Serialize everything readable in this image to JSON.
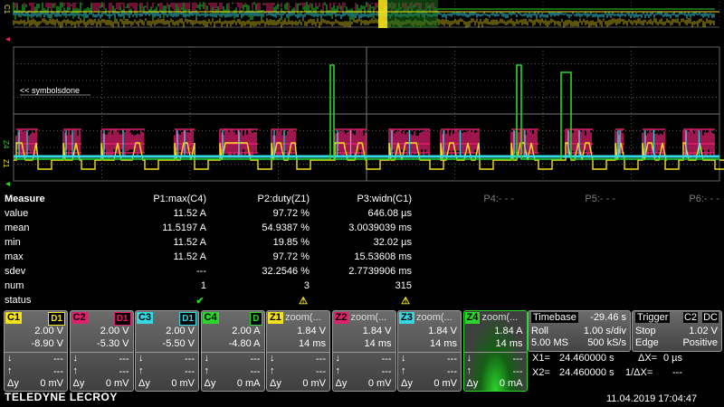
{
  "markers": {
    "c1": "C1",
    "z4": "Z4",
    "z1": "Z1"
  },
  "annotation": "<< symbolsdone",
  "measure": {
    "title": "Measure",
    "columns": [
      "P1:max(C4)",
      "P2:duty(Z1)",
      "P3:widn(C1)",
      "P4:- - -",
      "P5:- - -",
      "P6:- - -"
    ],
    "rows": [
      {
        "label": "value",
        "cells": [
          "11.52 A",
          "97.72 %",
          "646.08 µs"
        ]
      },
      {
        "label": "mean",
        "cells": [
          "11.5197 A",
          "54.9387 %",
          "3.0039039 ms"
        ]
      },
      {
        "label": "min",
        "cells": [
          "11.52 A",
          "19.85 %",
          "32.02 µs"
        ]
      },
      {
        "label": "max",
        "cells": [
          "11.52 A",
          "97.72 %",
          "15.53608 ms"
        ]
      },
      {
        "label": "sdev",
        "cells": [
          "---",
          "32.2546 %",
          "2.7739906 ms"
        ]
      },
      {
        "label": "num",
        "cells": [
          "1",
          "3",
          "315"
        ]
      },
      {
        "label": "status",
        "cells": [
          "✔",
          "⚠",
          "⚠"
        ]
      }
    ]
  },
  "channels": [
    {
      "tag": "C1",
      "coupling": "D1",
      "color": "#f3e21b",
      "v1": "2.00 V",
      "v2": "-8.90 V",
      "dn": "---",
      "up": "---",
      "dy": "0 mV"
    },
    {
      "tag": "C2",
      "coupling": "D1",
      "color": "#e0206e",
      "v1": "2.00 V",
      "v2": "-5.30 V",
      "dn": "---",
      "up": "---",
      "dy": "0 mV"
    },
    {
      "tag": "C3",
      "coupling": "D1",
      "color": "#34d8e3",
      "v1": "2.00 V",
      "v2": "-5.50 V",
      "dn": "---",
      "up": "---",
      "dy": "0 mV"
    },
    {
      "tag": "C4",
      "coupling": "D",
      "color": "#2bd52b",
      "v1": "2.00 A",
      "v2": "-4.80 A",
      "dn": "---",
      "up": "---",
      "dy": "0 mA"
    },
    {
      "tag": "Z1",
      "zoom": "zoom(...",
      "color": "#f3e21b",
      "v1": "1.84 V",
      "v2": "14 ms",
      "dn": "---",
      "up": "---",
      "dy": "0 mV"
    },
    {
      "tag": "Z2",
      "zoom": "zoom(...",
      "color": "#e0206e",
      "v1": "1.84 V",
      "v2": "14 ms",
      "dn": "---",
      "up": "---",
      "dy": "0 mV"
    },
    {
      "tag": "Z3",
      "zoom": "zoom(...",
      "color": "#34d8e3",
      "v1": "1.84 V",
      "v2": "14 ms",
      "dn": "---",
      "up": "---",
      "dy": "0 mV"
    },
    {
      "tag": "Z4",
      "zoom": "zoom(...",
      "color": "#2bd52b",
      "v1": "1.84 A",
      "v2": "14 ms",
      "dn": "---",
      "up": "---",
      "dy": "0 mA"
    }
  ],
  "timebase": {
    "label": "Timebase",
    "delay": "-29.46 s",
    "mode": "Roll",
    "div": "1.00 s/div",
    "samples": "5.00 MS",
    "rate": "500 kS/s"
  },
  "trigger": {
    "label": "Trigger",
    "channel": "C2",
    "coupling": "DC",
    "mode": "Stop",
    "level": "1.02 V",
    "type": "Edge",
    "slope": "Positive"
  },
  "cursors": {
    "x1": "X1=",
    "x1v": "24.460000 s",
    "x2": "X2=",
    "x2v": "24.460000 s",
    "dx": "ΔX=",
    "dxv": "0 µs",
    "idx": "1/ΔX=",
    "idxv": "---"
  },
  "brand": "TELEDYNE LECROY",
  "datetime": "11.04.2019 17:04:47"
}
